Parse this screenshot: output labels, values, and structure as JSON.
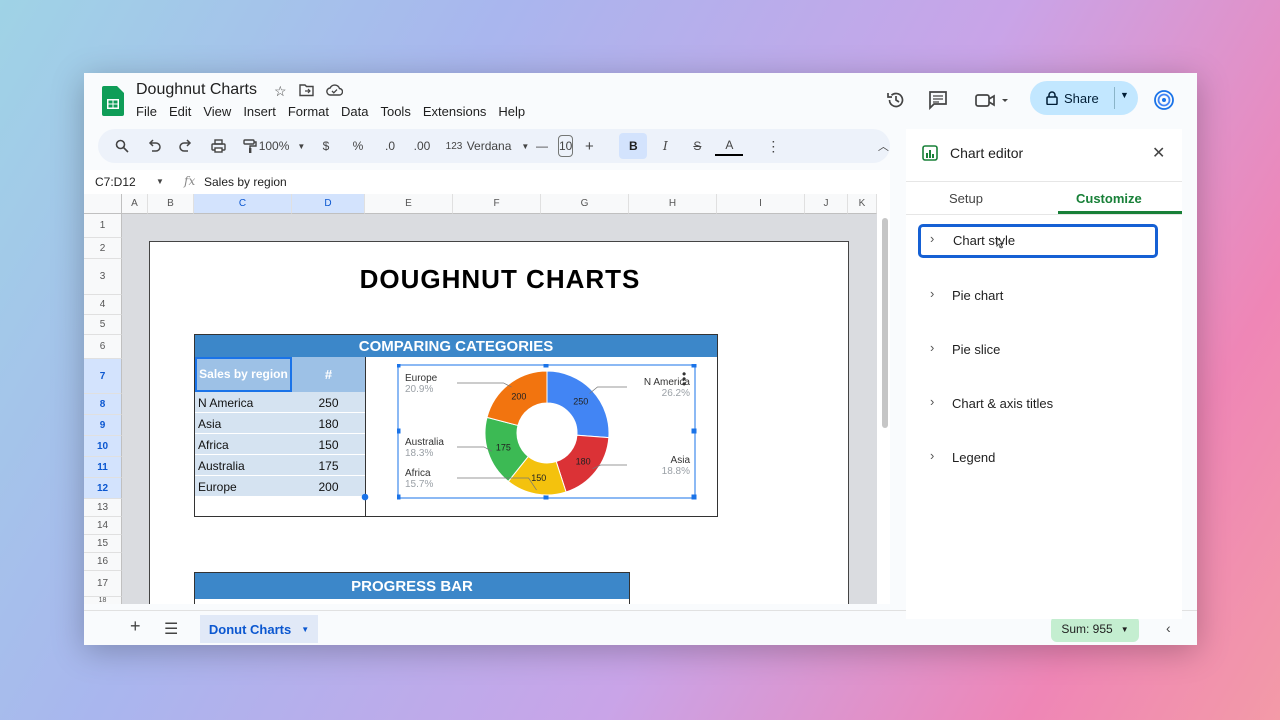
{
  "doc": {
    "title": "Doughnut Charts",
    "menu": [
      "File",
      "Edit",
      "View",
      "Insert",
      "Format",
      "Data",
      "Tools",
      "Extensions",
      "Help"
    ],
    "share_label": "Share"
  },
  "toolbar": {
    "zoom": "100%",
    "currency": "$",
    "percent": "%",
    "dec_decrease": ".0",
    "dec_increase": ".00",
    "number_format": "123",
    "font": "Verdana",
    "font_size": "10",
    "bold": "B",
    "italic": "I",
    "strike": "S",
    "text_color": "A"
  },
  "formula": {
    "name_box": "C7:D12",
    "fx": "fx",
    "value": "Sales by region"
  },
  "grid": {
    "columns": [
      "A",
      "B",
      "C",
      "D",
      "E",
      "F",
      "G",
      "H",
      "I",
      "J",
      "K"
    ],
    "rows": [
      "1",
      "2",
      "3",
      "4",
      "5",
      "6",
      "7",
      "8",
      "9",
      "10",
      "11",
      "12",
      "13",
      "14",
      "15",
      "16",
      "17",
      "18"
    ]
  },
  "sheet": {
    "title": "DOUGHNUT CHARTS",
    "section1": "COMPARING CATEGORIES",
    "table_header_region": "Sales by region",
    "table_header_value": "#",
    "rows": [
      {
        "region": "N America",
        "value": "250"
      },
      {
        "region": "Asia",
        "value": "180"
      },
      {
        "region": "Africa",
        "value": "150"
      },
      {
        "region": "Australia",
        "value": "175"
      },
      {
        "region": "Europe",
        "value": "200"
      }
    ],
    "section2": "PROGRESS BAR"
  },
  "chart_data": {
    "type": "pie",
    "hole": true,
    "categories": [
      "N America",
      "Asia",
      "Africa",
      "Australia",
      "Europe"
    ],
    "values": [
      250,
      180,
      150,
      175,
      200
    ],
    "percent_labels": [
      "26.2%",
      "18.8%",
      "15.7%",
      "18.3%",
      "20.9%"
    ],
    "colors": [
      "#4285f4",
      "#db3236",
      "#f4c20d",
      "#3cba54",
      "#f2740f"
    ]
  },
  "bottom": {
    "sheet_tab": "Donut Charts",
    "sum": "Sum: 955"
  },
  "editor": {
    "title": "Chart editor",
    "tabs": [
      "Setup",
      "Customize"
    ],
    "sections": [
      "Chart style",
      "Pie chart",
      "Pie slice",
      "Chart & axis titles",
      "Legend"
    ]
  }
}
